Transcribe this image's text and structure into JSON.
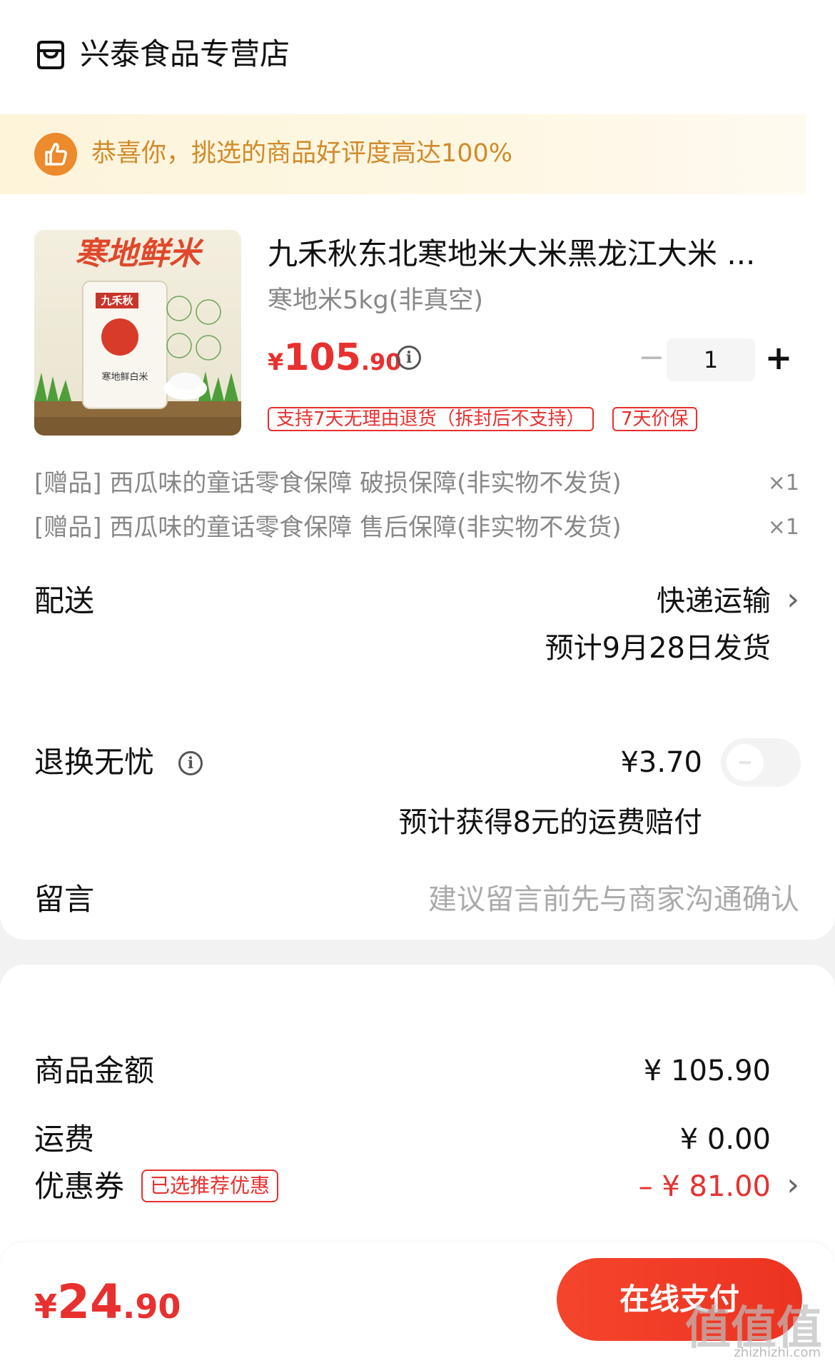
{
  "store": {
    "name": "兴泰食品专营店"
  },
  "banner": {
    "text": "恭喜你，挑选的商品好评度高达100%"
  },
  "product": {
    "image_text": "寒地鲜米",
    "bag_brand": "九禾秋",
    "bag_label": "寒地鲜白米",
    "title": "九禾秋东北寒地米大米黑龙江大米 ...",
    "spec": "寒地米5kg(非真空)",
    "price_symbol": "¥",
    "price_int": "105",
    "price_dec": ".90",
    "quantity": "1",
    "tags": [
      "支持7天无理由退货（拆封后不支持）",
      "7天价保"
    ]
  },
  "gifts": [
    {
      "text": "[赠品] 西瓜味的童话零食保障 破损保障(非实物不发货)",
      "qty": "×1"
    },
    {
      "text": "[赠品] 西瓜味的童话零食保障 售后保障(非实物不发货)",
      "qty": "×1"
    }
  ],
  "delivery": {
    "label": "配送",
    "method": "快递运输",
    "estimate": "预计9月28日发货"
  },
  "return_insurance": {
    "label": "退换无忧",
    "price": "¥3.70",
    "note": "预计获得8元的运费赔付",
    "enabled": false
  },
  "message": {
    "label": "留言",
    "placeholder": "建议留言前先与商家沟通确认"
  },
  "summary": {
    "goods_label": "商品金额",
    "goods_amount": "¥ 105.90",
    "shipping_label": "运费",
    "shipping_amount": "¥ 0.00",
    "coupon_label": "优惠券",
    "coupon_tag": "已选推荐优惠",
    "coupon_amount": "– ¥ 81.00"
  },
  "footer": {
    "total_symbol": "¥",
    "total_int": "24",
    "total_dec": ".90",
    "pay_label": "在线支付"
  },
  "watermark": {
    "text": "值值值",
    "sub": "zhizhizhi.com"
  },
  "colors": {
    "accent": "#e8302e",
    "banner_text": "#d28a29",
    "banner_icon": "#ec8a2c"
  }
}
